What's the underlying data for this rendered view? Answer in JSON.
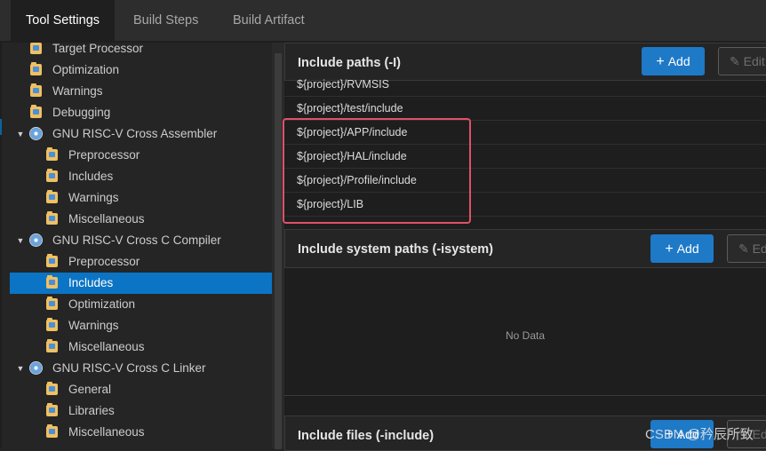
{
  "tabs": [
    "Tool Settings",
    "Build Steps",
    "Build Artifact"
  ],
  "tree": [
    {
      "label": "Target Processor",
      "icon": "folder"
    },
    {
      "label": "Optimization",
      "icon": "folder"
    },
    {
      "label": "Warnings",
      "icon": "folder"
    },
    {
      "label": "Debugging",
      "icon": "folder"
    },
    {
      "label": "GNU RISC-V Cross Assembler",
      "icon": "gear",
      "expanded": true
    },
    {
      "label": "Preprocessor",
      "icon": "folder"
    },
    {
      "label": "Includes",
      "icon": "folder"
    },
    {
      "label": "Warnings",
      "icon": "folder"
    },
    {
      "label": "Miscellaneous",
      "icon": "folder"
    },
    {
      "label": "GNU RISC-V Cross C Compiler",
      "icon": "gear",
      "expanded": true
    },
    {
      "label": "Preprocessor",
      "icon": "folder"
    },
    {
      "label": "Includes",
      "icon": "folder",
      "selected": true
    },
    {
      "label": "Optimization",
      "icon": "folder"
    },
    {
      "label": "Warnings",
      "icon": "folder"
    },
    {
      "label": "Miscellaneous",
      "icon": "folder"
    },
    {
      "label": "GNU RISC-V Cross C Linker",
      "icon": "gear",
      "expanded": true
    },
    {
      "label": "General",
      "icon": "folder"
    },
    {
      "label": "Libraries",
      "icon": "folder"
    },
    {
      "label": "Miscellaneous",
      "icon": "folder"
    }
  ],
  "include_paths": {
    "title": "Include paths (-I)",
    "add_label": "Add",
    "edit_label": "Edit",
    "items": [
      "${project}/RVMSIS",
      "${project}/test/include",
      "${project}/APP/include",
      "${project}/HAL/include",
      "${project}/Profile/include",
      "${project}/LIB"
    ]
  },
  "system_paths": {
    "title": "Include system paths (-isystem)",
    "add_label": "Add",
    "edit_label": "Edit",
    "empty_text": "No Data"
  },
  "include_files": {
    "title": "Include files (-include)",
    "add_label": "Add",
    "edit_label": "Edit"
  },
  "watermark": "CSDN @矜辰所致",
  "colors": {
    "accent": "#1e79c7",
    "selection": "#0b74c4",
    "highlight_box": "#e0506a"
  }
}
